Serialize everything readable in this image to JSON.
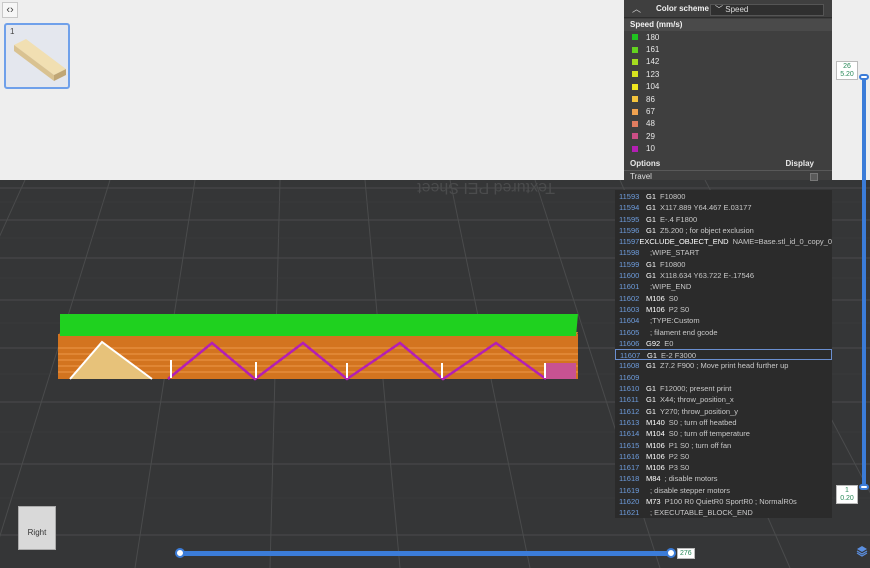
{
  "nav": {
    "collapse_icon": "‹›"
  },
  "thumbnail": {
    "index": "1"
  },
  "color_scheme": {
    "label": "Color scheme",
    "selected": "Speed",
    "legend_title": "Speed (mm/s)",
    "legend": [
      {
        "value": "180",
        "color": "#1fc21f"
      },
      {
        "value": "161",
        "color": "#63d21f"
      },
      {
        "value": "142",
        "color": "#a4dc1f"
      },
      {
        "value": "123",
        "color": "#d7e21f"
      },
      {
        "value": "104",
        "color": "#f0e61f"
      },
      {
        "value": "86",
        "color": "#f5c43c"
      },
      {
        "value": "67",
        "color": "#f0a250"
      },
      {
        "value": "48",
        "color": "#e07c60"
      },
      {
        "value": "29",
        "color": "#cc4e86"
      },
      {
        "value": "10",
        "color": "#b41fb4"
      }
    ],
    "options_label": "Options",
    "display_label": "Display",
    "travel_label": "Travel"
  },
  "gcode": {
    "lines": [
      {
        "num": "11593",
        "cmd": "G1",
        "args": "F10800"
      },
      {
        "num": "11594",
        "cmd": "G1",
        "args": "X117.889 Y64.467 E.03177"
      },
      {
        "num": "11595",
        "cmd": "G1",
        "args": "E-.4 F1800"
      },
      {
        "num": "11596",
        "cmd": "G1",
        "args": "Z5.200 ; for object exclusion"
      },
      {
        "num": "11597",
        "cmd": "EXCLUDE_OBJECT_END",
        "args": "NAME=Base.stl_id_0_copy_0"
      },
      {
        "num": "11598",
        "cmd": "",
        "args": ";WIPE_START"
      },
      {
        "num": "11599",
        "cmd": "G1",
        "args": "F10800"
      },
      {
        "num": "11600",
        "cmd": "G1",
        "args": "X118.634 Y63.722 E-.17546"
      },
      {
        "num": "11601",
        "cmd": "",
        "args": ";WIPE_END"
      },
      {
        "num": "11602",
        "cmd": "M106",
        "args": "S0"
      },
      {
        "num": "11603",
        "cmd": "M106",
        "args": "P2 S0"
      },
      {
        "num": "11604",
        "cmd": "",
        "args": ";TYPE:Custom"
      },
      {
        "num": "11605",
        "cmd": "",
        "args": "; filament end gcode"
      },
      {
        "num": "11606",
        "cmd": "G92",
        "args": "E0"
      },
      {
        "num": "11607",
        "cmd": "G1",
        "args": "E-2 F3000"
      },
      {
        "num": "11608",
        "cmd": "G1",
        "args": "Z7.2 F900 ; Move print head further up"
      },
      {
        "num": "11609",
        "cmd": "",
        "args": ""
      },
      {
        "num": "11610",
        "cmd": "G1",
        "args": "F12000; present print"
      },
      {
        "num": "11611",
        "cmd": "G1",
        "args": "X44; throw_position_x"
      },
      {
        "num": "11612",
        "cmd": "G1",
        "args": "Y270; throw_position_y"
      },
      {
        "num": "11613",
        "cmd": "M140",
        "args": "S0 ; turn off heatbed"
      },
      {
        "num": "11614",
        "cmd": "M104",
        "args": "S0 ; turn off temperature"
      },
      {
        "num": "11615",
        "cmd": "M106",
        "args": "P1 S0 ; turn off fan"
      },
      {
        "num": "11616",
        "cmd": "M106",
        "args": "P2 S0"
      },
      {
        "num": "11617",
        "cmd": "M106",
        "args": "P3 S0"
      },
      {
        "num": "11618",
        "cmd": "M84",
        "args": "; disable motors"
      },
      {
        "num": "11619",
        "cmd": "",
        "args": "; disable stepper motors"
      },
      {
        "num": "11620",
        "cmd": "M73",
        "args": "P100 R0 QuietR0 SportR0 ; NormalR0s"
      },
      {
        "num": "11621",
        "cmd": "",
        "args": "; EXECUTABLE_BLOCK_END"
      }
    ],
    "selected_index": 14
  },
  "vertical_slider": {
    "top_layer": "26",
    "top_height": "5.20",
    "bottom_layer": "1",
    "bottom_height": "0.20"
  },
  "horizontal_slider": {
    "value": "276"
  },
  "view_cube": {
    "label": "Right"
  },
  "bed_text": "Textured PEI Sheet",
  "icons": {
    "layers": "layers-icon"
  }
}
